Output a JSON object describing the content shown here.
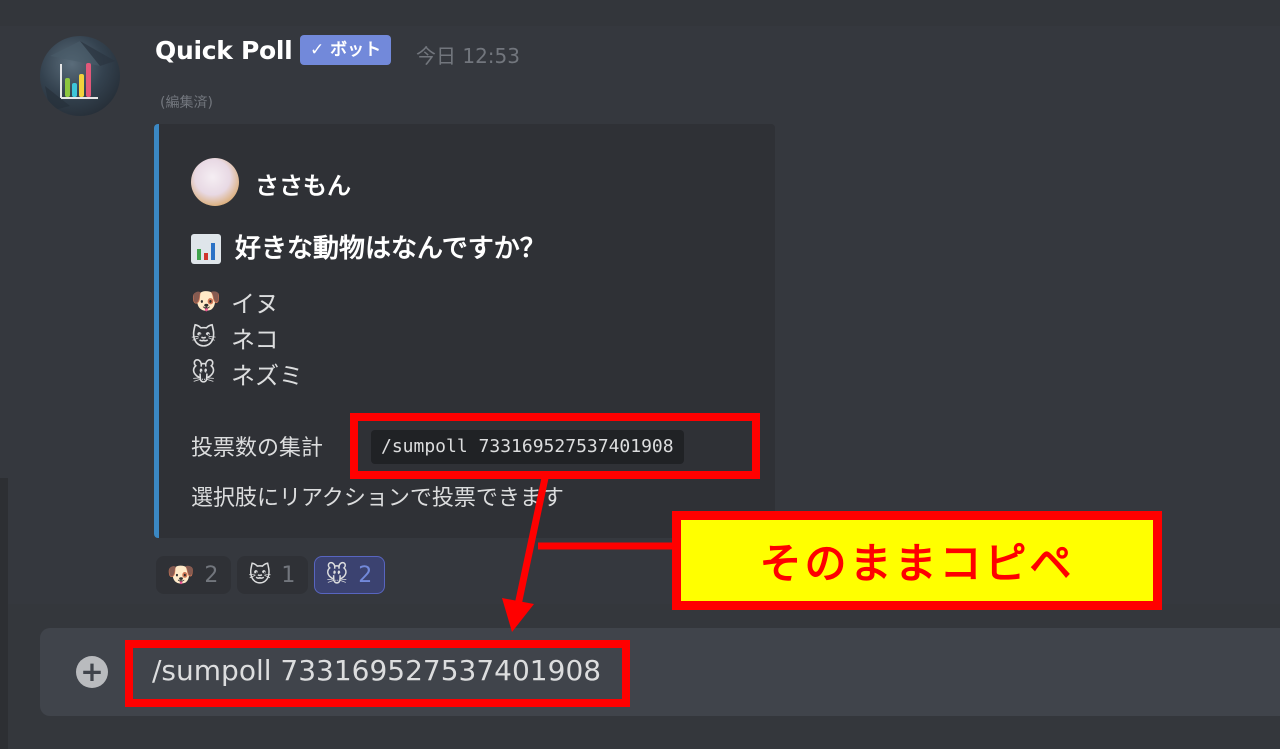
{
  "message": {
    "author": "Quick Poll",
    "bot_badge": "✓ ボット",
    "timestamp": "今日 12:53",
    "edited": "(編集済)"
  },
  "embed": {
    "accent_color": "#3b88c3",
    "author_name": "ささもん",
    "title": "好きな動物はなんですか？",
    "options": [
      {
        "emoji": "🐶",
        "label": "イヌ"
      },
      {
        "emoji": "🐱",
        "label": "ネコ"
      },
      {
        "emoji": "🐭",
        "label": "ネズミ"
      }
    ],
    "sum_label": "投票数の集計",
    "sum_command": "/sumpoll 733169527537401908",
    "howto": "選択肢にリアクションで投票できます"
  },
  "reactions": [
    {
      "emoji": "🐶",
      "count": "2",
      "reacted": false
    },
    {
      "emoji": "🐱",
      "count": "1",
      "reacted": false
    },
    {
      "emoji": "🐭",
      "count": "2",
      "reacted": true
    }
  ],
  "composer": {
    "value": "/sumpoll 733169527537401908",
    "add_icon": "plus-icon"
  },
  "annotation": {
    "callout": "そのままコピペ",
    "color": "#ff0000",
    "fill": "#ffff00"
  }
}
